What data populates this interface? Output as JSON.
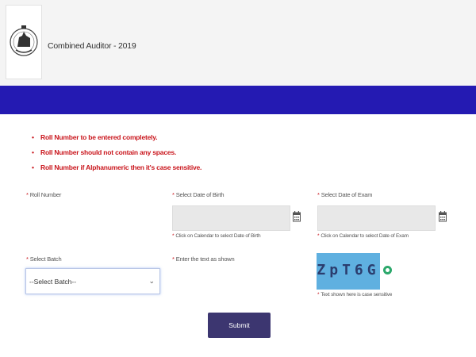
{
  "header": {
    "title": "Combined Auditor - 2019",
    "logo_icon": "state-emblem-icon"
  },
  "colors": {
    "nav_bar": "#241ab2",
    "error_text": "#c9141b",
    "submit_button": "#3c3670",
    "captcha_bg": "#5fb0e0"
  },
  "instructions": [
    "Roll Number to be entered completely.",
    "Roll Number should not contain any spaces.",
    "Roll Number if Alphanumeric then it's case sensitive."
  ],
  "form": {
    "roll_number": {
      "label": "Roll Number"
    },
    "date_of_birth": {
      "label": "Select Date of Birth",
      "value": "",
      "hint": "Click on Calendar to select Date of Birth",
      "icon": "calendar-icon"
    },
    "date_of_exam": {
      "label": "Select Date of Exam",
      "value": "",
      "hint": "Click on Calendar to select Date of Exam",
      "icon": "calendar-icon"
    },
    "batch": {
      "label": "Select Batch",
      "selected": "--Select Batch--"
    },
    "captcha": {
      "label": "Enter the text as shown",
      "image_text": "ZpT6G",
      "hint": "Text shown here is case sensitive",
      "refresh_icon": "refresh-icon"
    },
    "submit_label": "Submit"
  }
}
